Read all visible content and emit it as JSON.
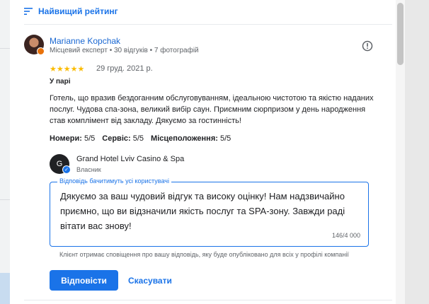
{
  "sort": {
    "label": "Найвищий рейтинг",
    "icon": "sort-icon"
  },
  "review": {
    "reviewer_name": "Marianne Kopchak",
    "reviewer_meta": "Місцевий експерт • 30 відгуків • 7 фотографій",
    "rating": 5,
    "stars": "★★★★★",
    "date": "29 груд. 2021 р.",
    "trip_type": "У парі",
    "text": "Готель, що вразив бездоганним обслуговуванням, ідеальною чистотою та якістю наданих послуг. Чудова спа-зона, великий вибір саун. Приємним сюрпризом у день народження став комплімент від закладу. Дякуємо за гостинність!",
    "ratings": [
      {
        "label": "Номери:",
        "value": "5/5"
      },
      {
        "label": "Сервіс:",
        "value": "5/5"
      },
      {
        "label": "Місцеположення:",
        "value": "5/5"
      }
    ]
  },
  "owner": {
    "name": "Grand Hotel Lviv Casino & Spa",
    "role": "Власник",
    "avatar_initials": "G"
  },
  "reply": {
    "label": "Відповідь бачитимуть усі користувачі",
    "value": "Дякуємо за ваш чудовий відгук та високу оцінку! Нам надзвичайно приємно, що ви відзначили якість послуг та SPA-зону. Завжди раді вітати вас знову!",
    "counter": "146/4 000",
    "notice": "Клієнт отримає сповіщення про вашу відповідь, яку буде опубліковано для всіх у профілі компанії"
  },
  "actions": {
    "reply_label": "Відповісти",
    "cancel_label": "Скасувати"
  },
  "colors": {
    "accent": "#1a73e8",
    "star": "#fbbc04"
  }
}
